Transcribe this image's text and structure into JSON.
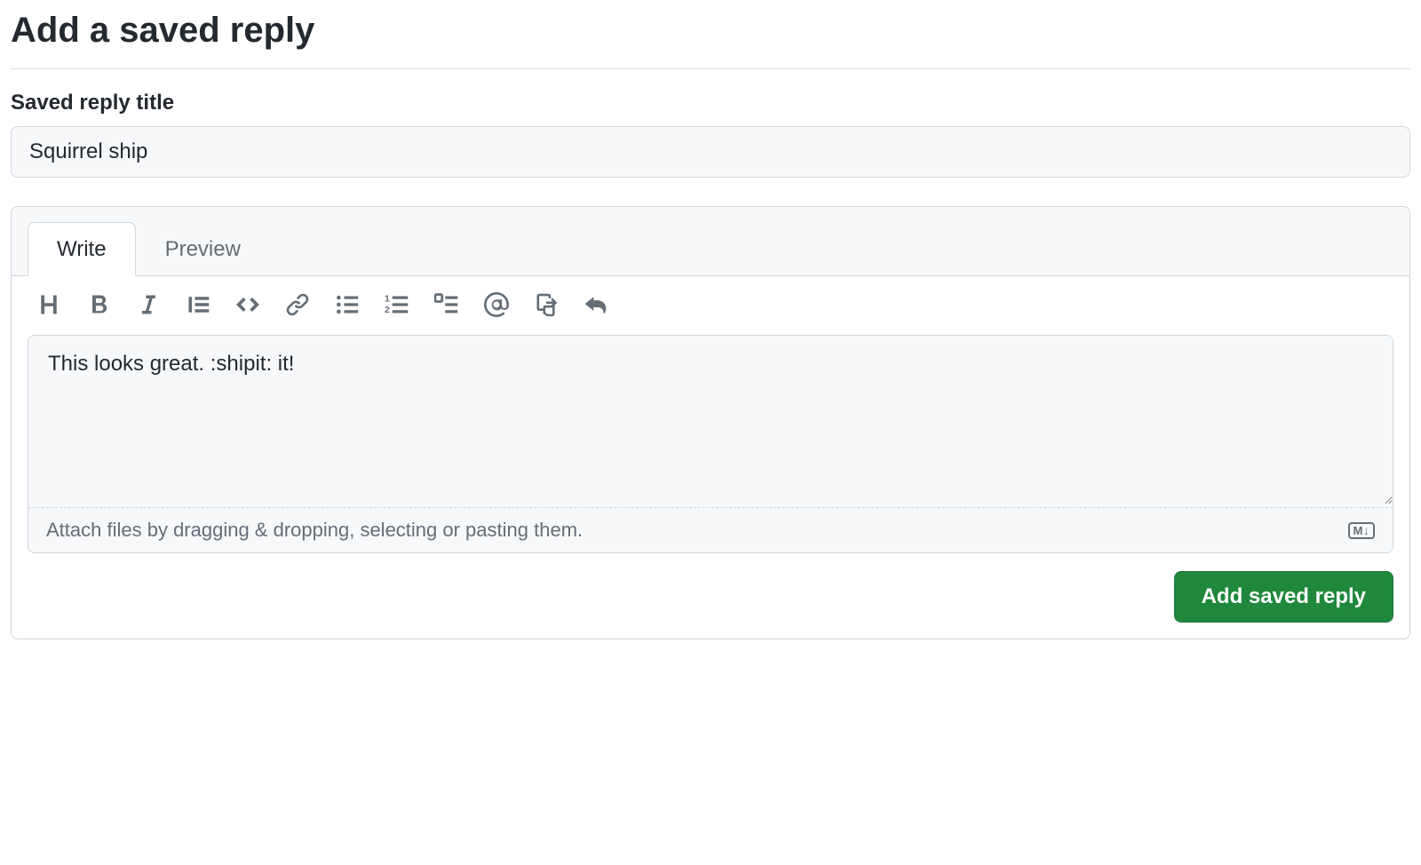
{
  "page": {
    "heading": "Add a saved reply"
  },
  "title_field": {
    "label": "Saved reply title",
    "value": "Squirrel ship"
  },
  "editor": {
    "tabs": {
      "write": "Write",
      "preview": "Preview"
    },
    "toolbar_icons": [
      "heading-icon",
      "bold-icon",
      "italic-icon",
      "quote-icon",
      "code-icon",
      "link-icon",
      "unordered-list-icon",
      "ordered-list-icon",
      "task-list-icon",
      "mention-icon",
      "cross-reference-icon",
      "reply-icon"
    ],
    "body_value": "This looks great. :shipit: it!",
    "attach_hint": "Attach files by dragging & dropping, selecting or pasting them.",
    "markdown_badge": "M↓"
  },
  "actions": {
    "submit_label": "Add saved reply"
  }
}
